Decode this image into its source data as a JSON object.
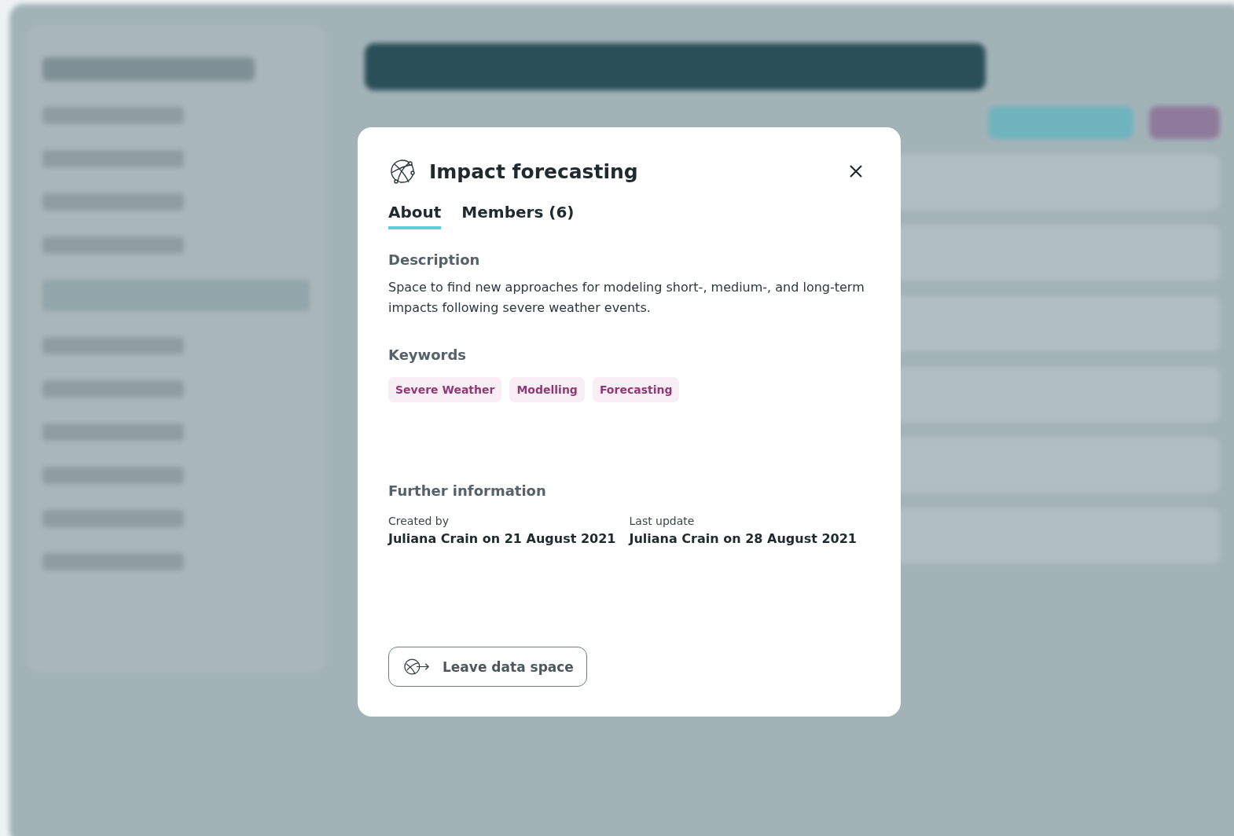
{
  "dialog": {
    "title": "Impact forecasting",
    "tabs": [
      {
        "label": "About",
        "selected": true
      },
      {
        "label": "Members (6)",
        "selected": false
      }
    ],
    "description": {
      "heading": "Description",
      "text": "Space to find new approaches for modeling short-, medium-, and long-term impacts following severe weather events."
    },
    "keywords": {
      "heading": "Keywords",
      "tags": [
        "Severe Weather",
        "Modelling",
        "Forecasting"
      ]
    },
    "further_information": {
      "heading": "Further information",
      "fields": [
        {
          "label": "Created by",
          "value": "Juliana Crain on 21 August 2021"
        },
        {
          "label": "Last update",
          "value": "Juliana Crain on 28 August 2021"
        }
      ]
    },
    "leave_button": "Leave data space"
  }
}
